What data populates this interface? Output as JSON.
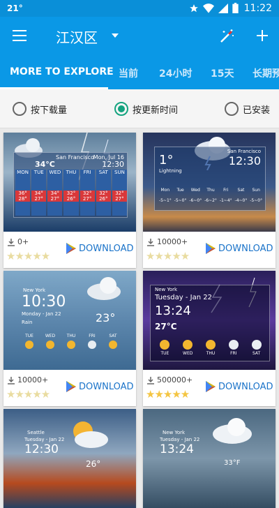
{
  "status": {
    "temp": "21°",
    "time": "11:22"
  },
  "header": {
    "city": "江汉区"
  },
  "tabs": [
    "MORE TO EXPLORE",
    "当前",
    "24小时",
    "15天",
    "长期预"
  ],
  "filters": [
    {
      "label": "按下载量",
      "checked": false
    },
    {
      "label": "按更新时间",
      "checked": true
    },
    {
      "label": "已安装",
      "checked": false
    }
  ],
  "cards": [
    {
      "downloads": "0+",
      "rating": 0,
      "action": "DOWNLOAD",
      "preview": {
        "city": "San Francisco",
        "date": "Mon, Jul 16",
        "temp": "34°C",
        "time": "12:30",
        "days": [
          "MON",
          "TUE",
          "WED",
          "THU",
          "FRI",
          "SAT",
          "SUN"
        ],
        "highs": [
          "36°",
          "34°",
          "34°",
          "32°",
          "32°",
          "32°",
          "32°"
        ],
        "lows": [
          "28°",
          "27°",
          "27°",
          "26°",
          "27°",
          "26°",
          "27°"
        ]
      }
    },
    {
      "downloads": "10000+",
      "rating": 0,
      "action": "DOWNLOAD",
      "preview": {
        "city": "San Francisco",
        "temp": "1°",
        "time": "12:30",
        "cond": "Lightning",
        "days": [
          "Mon",
          "Tue",
          "Wed",
          "Thu",
          "Fri",
          "Sat",
          "Sun"
        ],
        "temps": [
          "-5~1°",
          "-5~0°",
          "-6~0°",
          "-6~2°",
          "-1~4°",
          "-4~0°",
          "-5~0°"
        ]
      }
    },
    {
      "downloads": "10000+",
      "rating": 0,
      "action": "DOWNLOAD",
      "preview": {
        "city": "New York",
        "time": "10:30",
        "date": "Monday - Jan 22",
        "cond": "Rain",
        "temp": "23°",
        "days": [
          "TUE",
          "WED",
          "THU",
          "FRI",
          "SAT"
        ]
      }
    },
    {
      "downloads": "500000+",
      "rating": 5,
      "action": "DOWNLOAD",
      "preview": {
        "city": "New York",
        "date": "Tuesday - Jan 22",
        "time": "13:24",
        "temp": "27°C",
        "days": [
          "TUE",
          "WED",
          "THU",
          "FRI",
          "SAT"
        ]
      }
    },
    {
      "downloads": "",
      "rating": 0,
      "action": "",
      "preview": {
        "city": "Seattle",
        "date": "Tuesday - Jan 22",
        "time": "12:30",
        "temp": "26°"
      }
    },
    {
      "downloads": "",
      "rating": 0,
      "action": "",
      "preview": {
        "city": "New York",
        "date": "Tuesday - Jan 22",
        "time": "13:24",
        "temp": "33°F"
      }
    }
  ],
  "colors": {
    "primary": "#0a98e6",
    "accent_radio": "#14a37f",
    "star": "#f4c542",
    "download_text": "#1a73c9"
  }
}
